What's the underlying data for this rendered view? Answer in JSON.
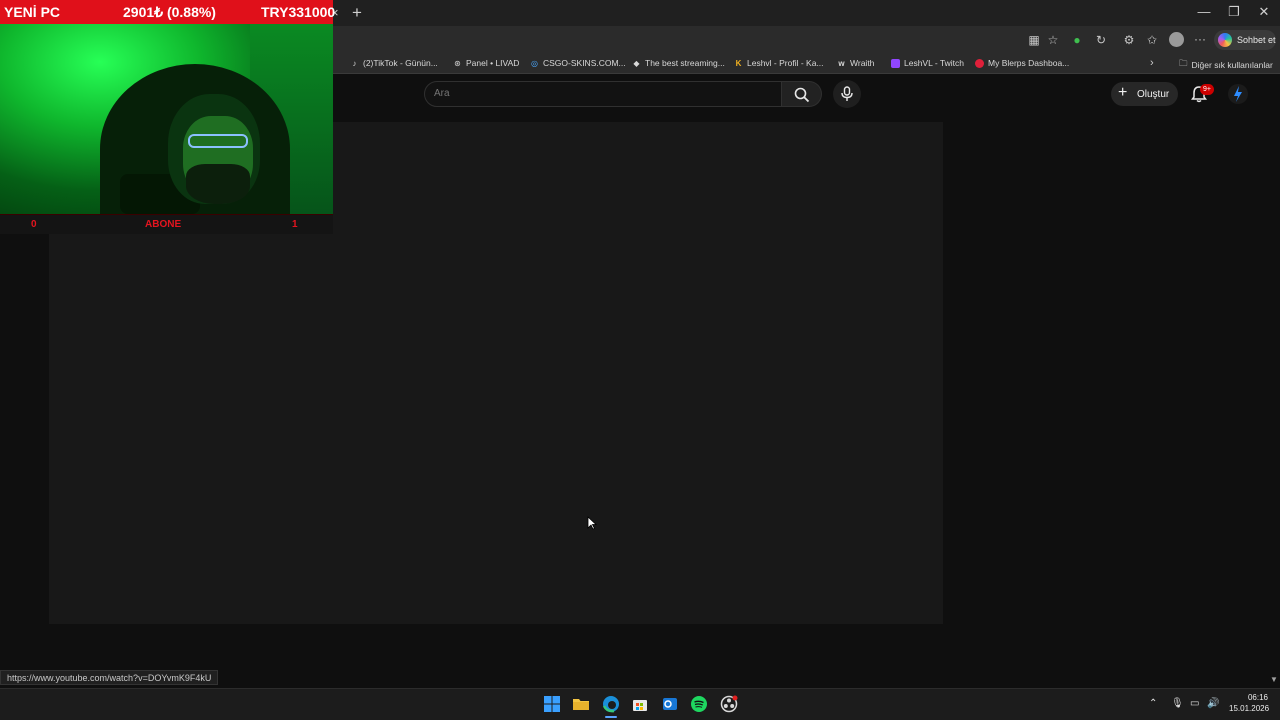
{
  "overlay": {
    "title": "YENİ PC",
    "price": "2901₺ (0.88%)",
    "goal": "TRY331000",
    "counter_left": "0",
    "counter_label": "ABONE",
    "counter_right": "1"
  },
  "browser": {
    "tab_close_glyph": "×",
    "new_tab_glyph": "+",
    "window_controls": [
      "—",
      "❐",
      "✕"
    ],
    "copilot_label": "Sohbet et",
    "more_glyph": "···",
    "bookmarks": [
      {
        "label": "(2)TikTok - Günün...",
        "icon": "tiktok-icon"
      },
      {
        "label": "Panel • LIVAD",
        "icon": "livad-icon"
      },
      {
        "label": "CSGO-SKINS.COM...",
        "icon": "globe-icon"
      },
      {
        "label": "The best streaming...",
        "icon": "diamond-icon"
      },
      {
        "label": "Leshvl - Profil - Ka...",
        "icon": "kick-icon"
      },
      {
        "label": "Wraith",
        "icon": "w-icon"
      },
      {
        "label": "LeshVL - Twitch",
        "icon": "twitch-icon"
      },
      {
        "label": "My Blerps Dashboa...",
        "icon": "blerp-icon"
      }
    ],
    "bookmarks_more": "›",
    "other_bookmarks": "Diğer sık kullanılanlar",
    "status_url": "https://www.youtube.com/watch?v=DOYvmK9F4kU"
  },
  "youtube": {
    "search_placeholder": "Ara",
    "create_label": "Oluştur",
    "notification_badge": "9+"
  },
  "taskbar": {
    "apps": [
      "windows-start",
      "file-explorer",
      "edge",
      "microsoft-store",
      "outlook",
      "spotify",
      "obs"
    ],
    "time": "06:16",
    "date": "15.01.2026"
  },
  "colors": {
    "overlay_red": "#e0101a",
    "counter_red": "#e3141f",
    "badge_red": "#cc0000"
  }
}
